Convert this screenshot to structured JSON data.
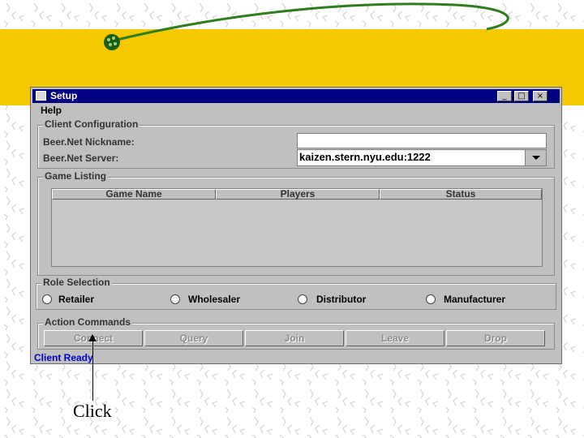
{
  "colors": {
    "slide_accent": "#f5c800",
    "titlebar": "#000080",
    "window_bg": "#c0c0c0",
    "status_text": "#0000cc"
  },
  "window": {
    "title": "Setup",
    "controls": {
      "minimize": "_",
      "maximize": "□",
      "close": "×"
    }
  },
  "menu": {
    "help": "Help"
  },
  "client_config": {
    "legend": "Client Configuration",
    "nickname_label": "Beer.Net Nickname:",
    "nickname_value": "",
    "server_label": "Beer.Net Server:",
    "server_value": "kaizen.stern.nyu.edu:1222"
  },
  "game_listing": {
    "legend": "Game Listing",
    "columns": [
      "Game Name",
      "Players",
      "Status"
    ]
  },
  "role_selection": {
    "legend": "Role Selection",
    "roles": [
      "Retailer",
      "Wholesaler",
      "Distributor",
      "Manufacturer"
    ]
  },
  "actions": {
    "legend": "Action Commands",
    "buttons": [
      "Connect",
      "Query",
      "Join",
      "Leave",
      "Drop"
    ]
  },
  "status": "Client Ready",
  "annotation": "Click"
}
